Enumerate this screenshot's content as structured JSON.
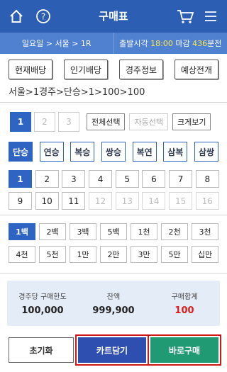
{
  "header": {
    "title": "구매표",
    "icons": [
      "home-icon",
      "help-icon",
      "cart-icon",
      "menu-icon"
    ]
  },
  "info": {
    "race_text": "일요일 > 서울 > 1R",
    "start_prefix": "출발시각",
    "start_time": "18:00",
    "deadline_label": "마감",
    "deadline_value": "436",
    "deadline_unit": "분전"
  },
  "tabs": [
    "현재배당",
    "인기배당",
    "경주정보",
    "예상전개"
  ],
  "breadcrumb": "서울>1경주>단승>1>100>100",
  "pages": {
    "items": [
      "1",
      "2",
      "3"
    ],
    "selected": 0
  },
  "select_buttons": {
    "all": "전체선택",
    "auto": "자동선택",
    "zoom": "크게보기"
  },
  "bet_types": {
    "items": [
      "단승",
      "연승",
      "복승",
      "쌍승",
      "복연",
      "삼복",
      "삼쌍"
    ],
    "selected": 0
  },
  "numbers": {
    "row1": [
      "1",
      "2",
      "3",
      "4",
      "5",
      "6",
      "7",
      "8"
    ],
    "row2": [
      "9",
      "10",
      "11",
      "12",
      "13",
      "14",
      "15",
      "16"
    ],
    "selected": "1",
    "disabled": [
      "12",
      "13",
      "14",
      "15",
      "16"
    ]
  },
  "amounts": {
    "row1": [
      "1백",
      "2백",
      "3백",
      "5백",
      "1천",
      "2천",
      "3천"
    ],
    "row2": [
      "4천",
      "5천",
      "1만",
      "2만",
      "3만",
      "5만",
      "십만"
    ],
    "selected": "1백"
  },
  "summary": {
    "limit_label": "경주당 구매한도",
    "limit_value": "100,000",
    "balance_label": "잔액",
    "balance_value": "999,900",
    "total_label": "구매합계",
    "total_value": "100"
  },
  "actions": {
    "reset": "초기화",
    "cart": "카트담기",
    "buy": "바로구매"
  },
  "colors": {
    "header": "#2c5fb3",
    "infobar": "#4f81d0",
    "accent": "#2f64c2",
    "highlight": "#ffe74a",
    "total": "#e21b1b",
    "buy": "#1f9a72",
    "cart": "#2e4fb0"
  }
}
